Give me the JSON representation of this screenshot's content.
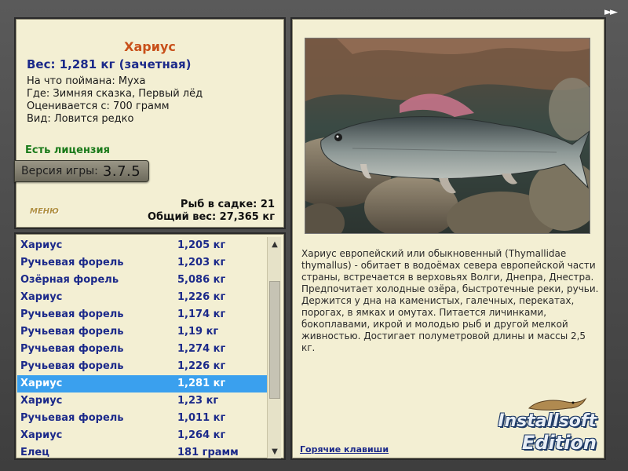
{
  "info": {
    "fish_name": "Хариус",
    "weight": "Вес: 1,281 кг (зачетная)",
    "lines": [
      "На что поймана: Муха",
      "Где: Зимняя сказка, Первый лёд",
      "Оценивается с: 700 грамм",
      "Вид: Ловится редко"
    ],
    "license": "Есть лицензия",
    "version_label": "Версия игры:",
    "version_number": "3.7.5",
    "logo_text": "MEHЮ",
    "fish_in_cage": "Рыб в садке: 21",
    "total_weight": "Общий вес: 27,365 кг"
  },
  "catch_list": {
    "rows": [
      {
        "name": "Хариус",
        "weight": "1,205 кг"
      },
      {
        "name": "Ручьевая форель",
        "weight": "1,203 кг"
      },
      {
        "name": "Озёрная форель",
        "weight": "5,086 кг"
      },
      {
        "name": "Хариус",
        "weight": "1,226 кг"
      },
      {
        "name": "Ручьевая форель",
        "weight": "1,174 кг"
      },
      {
        "name": "Ручьевая форель",
        "weight": "1,19 кг"
      },
      {
        "name": "Ручьевая форель",
        "weight": "1,274 кг"
      },
      {
        "name": "Ручьевая форель",
        "weight": "1,226 кг"
      },
      {
        "name": "Хариус",
        "weight": "1,281 кг"
      },
      {
        "name": "Хариус",
        "weight": "1,23 кг"
      },
      {
        "name": "Ручьевая форель",
        "weight": "1,011 кг"
      },
      {
        "name": "Хариус",
        "weight": "1,264 кг"
      },
      {
        "name": "Елец",
        "weight": "181 грамм"
      }
    ],
    "selected_index": 8,
    "scroll_up_icon": "triangle-up-icon",
    "scroll_down_icon": "triangle-down-icon"
  },
  "description": {
    "text": "Хариус европейский или обыкновенный (Thymallidae thymallus) - обитает в водоёмах севера европейской части страны, встречается в верховьях Волги, Днепра, Днестра. Предпочитает холодные озёра, быстротечные реки, ручьи. Держится у дна на каменистых, галечных, перекатах, порогах, в ямках и омутах. Питается личинками, бокоплавами, икрой и молодью рыб и другой мелкой живностью. Достигает полуметровой длины и массы 2,5 кг.",
    "hotkeys_link": "Горячие клавиши"
  },
  "watermark": {
    "line1": "Installsoft",
    "line2": "Edition"
  },
  "skip_button": {
    "label": "►►",
    "icon": "fast-forward-icon"
  },
  "colors": {
    "panel_bg": "#f3efd3",
    "title": "#c8501a",
    "list_text": "#1c2a8a",
    "selected_bg": "#3aa0ee",
    "license": "#1a7a1a"
  }
}
